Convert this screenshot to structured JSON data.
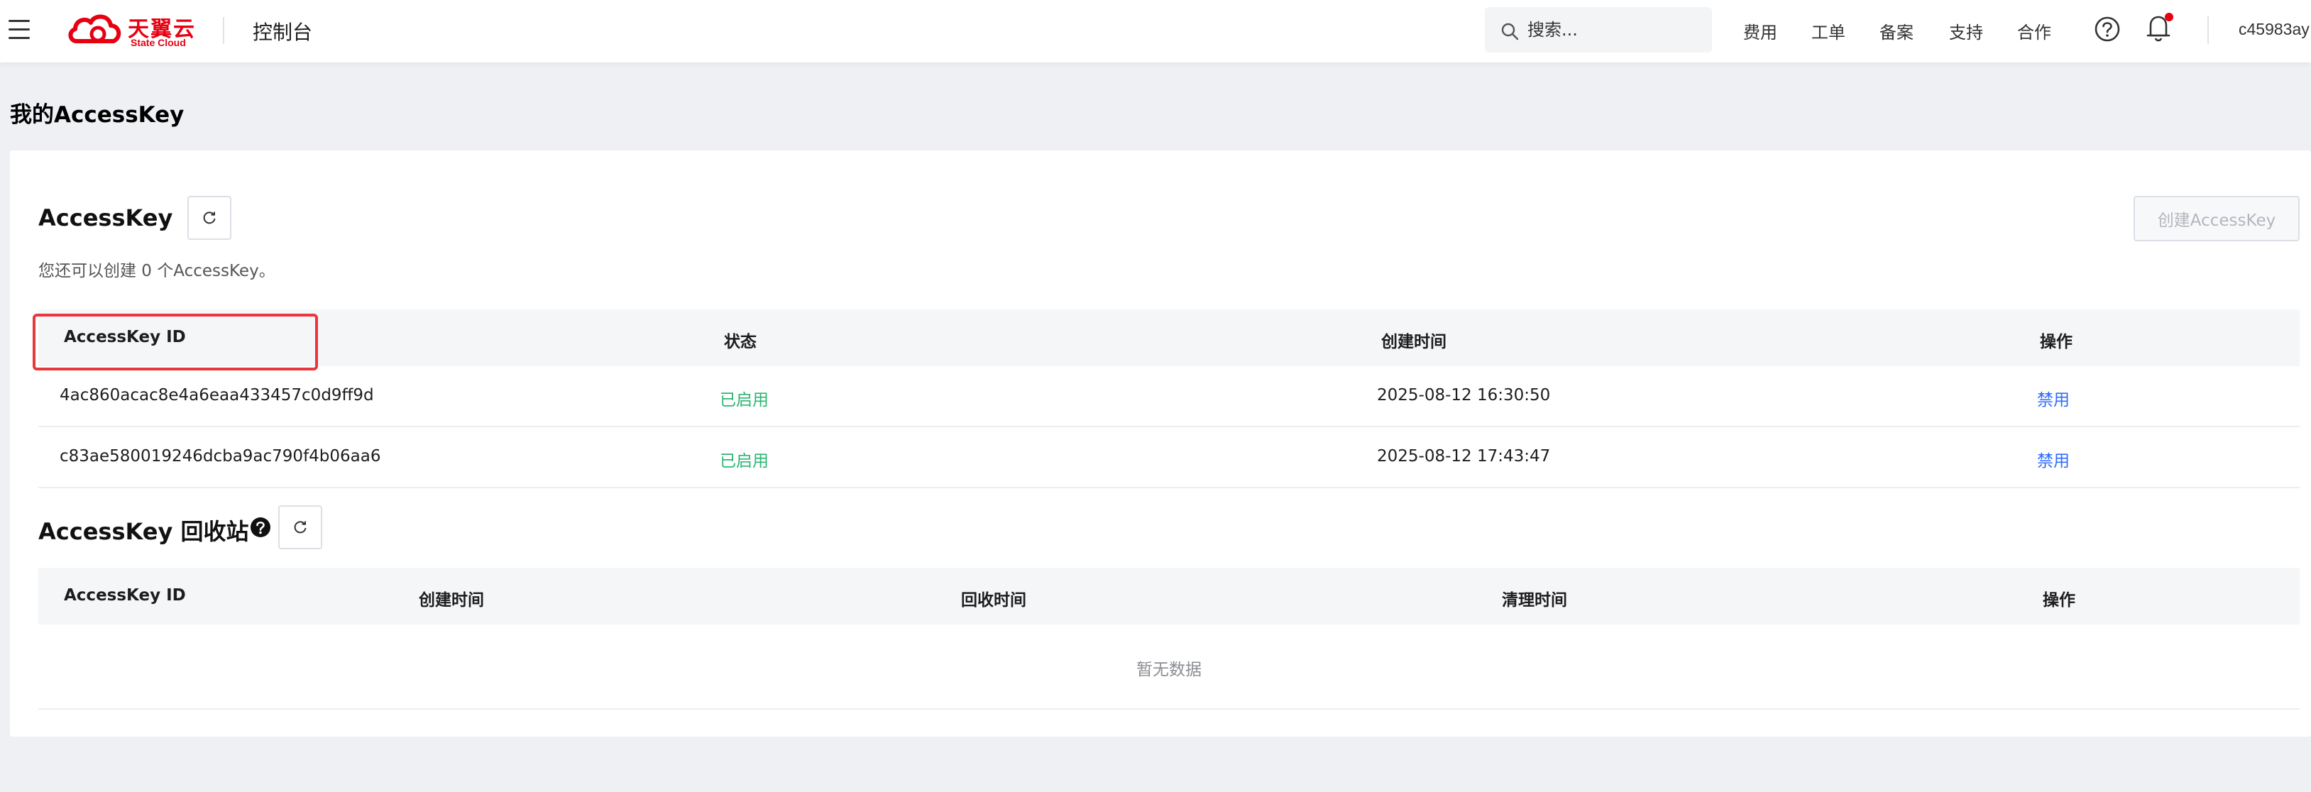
{
  "header": {
    "logo": {
      "cn": "天翼云",
      "en": "State Cloud"
    },
    "console_title": "控制台",
    "search_placeholder": "搜索...",
    "nav": [
      "费用",
      "工单",
      "备案",
      "支持",
      "合作"
    ],
    "user": "c45983ay"
  },
  "page": {
    "title": "我的AccessKey"
  },
  "accesskey": {
    "title": "AccessKey",
    "create_label": "创建AccessKey",
    "hint": "您还可以创建 0 个AccessKey。",
    "columns": [
      "AccessKey ID",
      "状态",
      "创建时间",
      "操作"
    ],
    "rows": [
      {
        "id": "4ac860acac8e4a6eaa433457c0d9ff9d",
        "status": "已启用",
        "created": "2025-08-12 16:30:50",
        "action": "禁用"
      },
      {
        "id": "c83ae580019246dcba9ac790f4b06aa6",
        "status": "已启用",
        "created": "2025-08-12 17:43:47",
        "action": "禁用"
      }
    ]
  },
  "recycle": {
    "title": "AccessKey 回收站",
    "columns": [
      "AccessKey ID",
      "创建时间",
      "回收时间",
      "清理时间",
      "操作"
    ],
    "empty_text": "暂无数据"
  },
  "colors": {
    "brand": "#e60012",
    "enabled": "#2bb673",
    "link": "#2f6bff",
    "highlight": "#e8373d"
  }
}
